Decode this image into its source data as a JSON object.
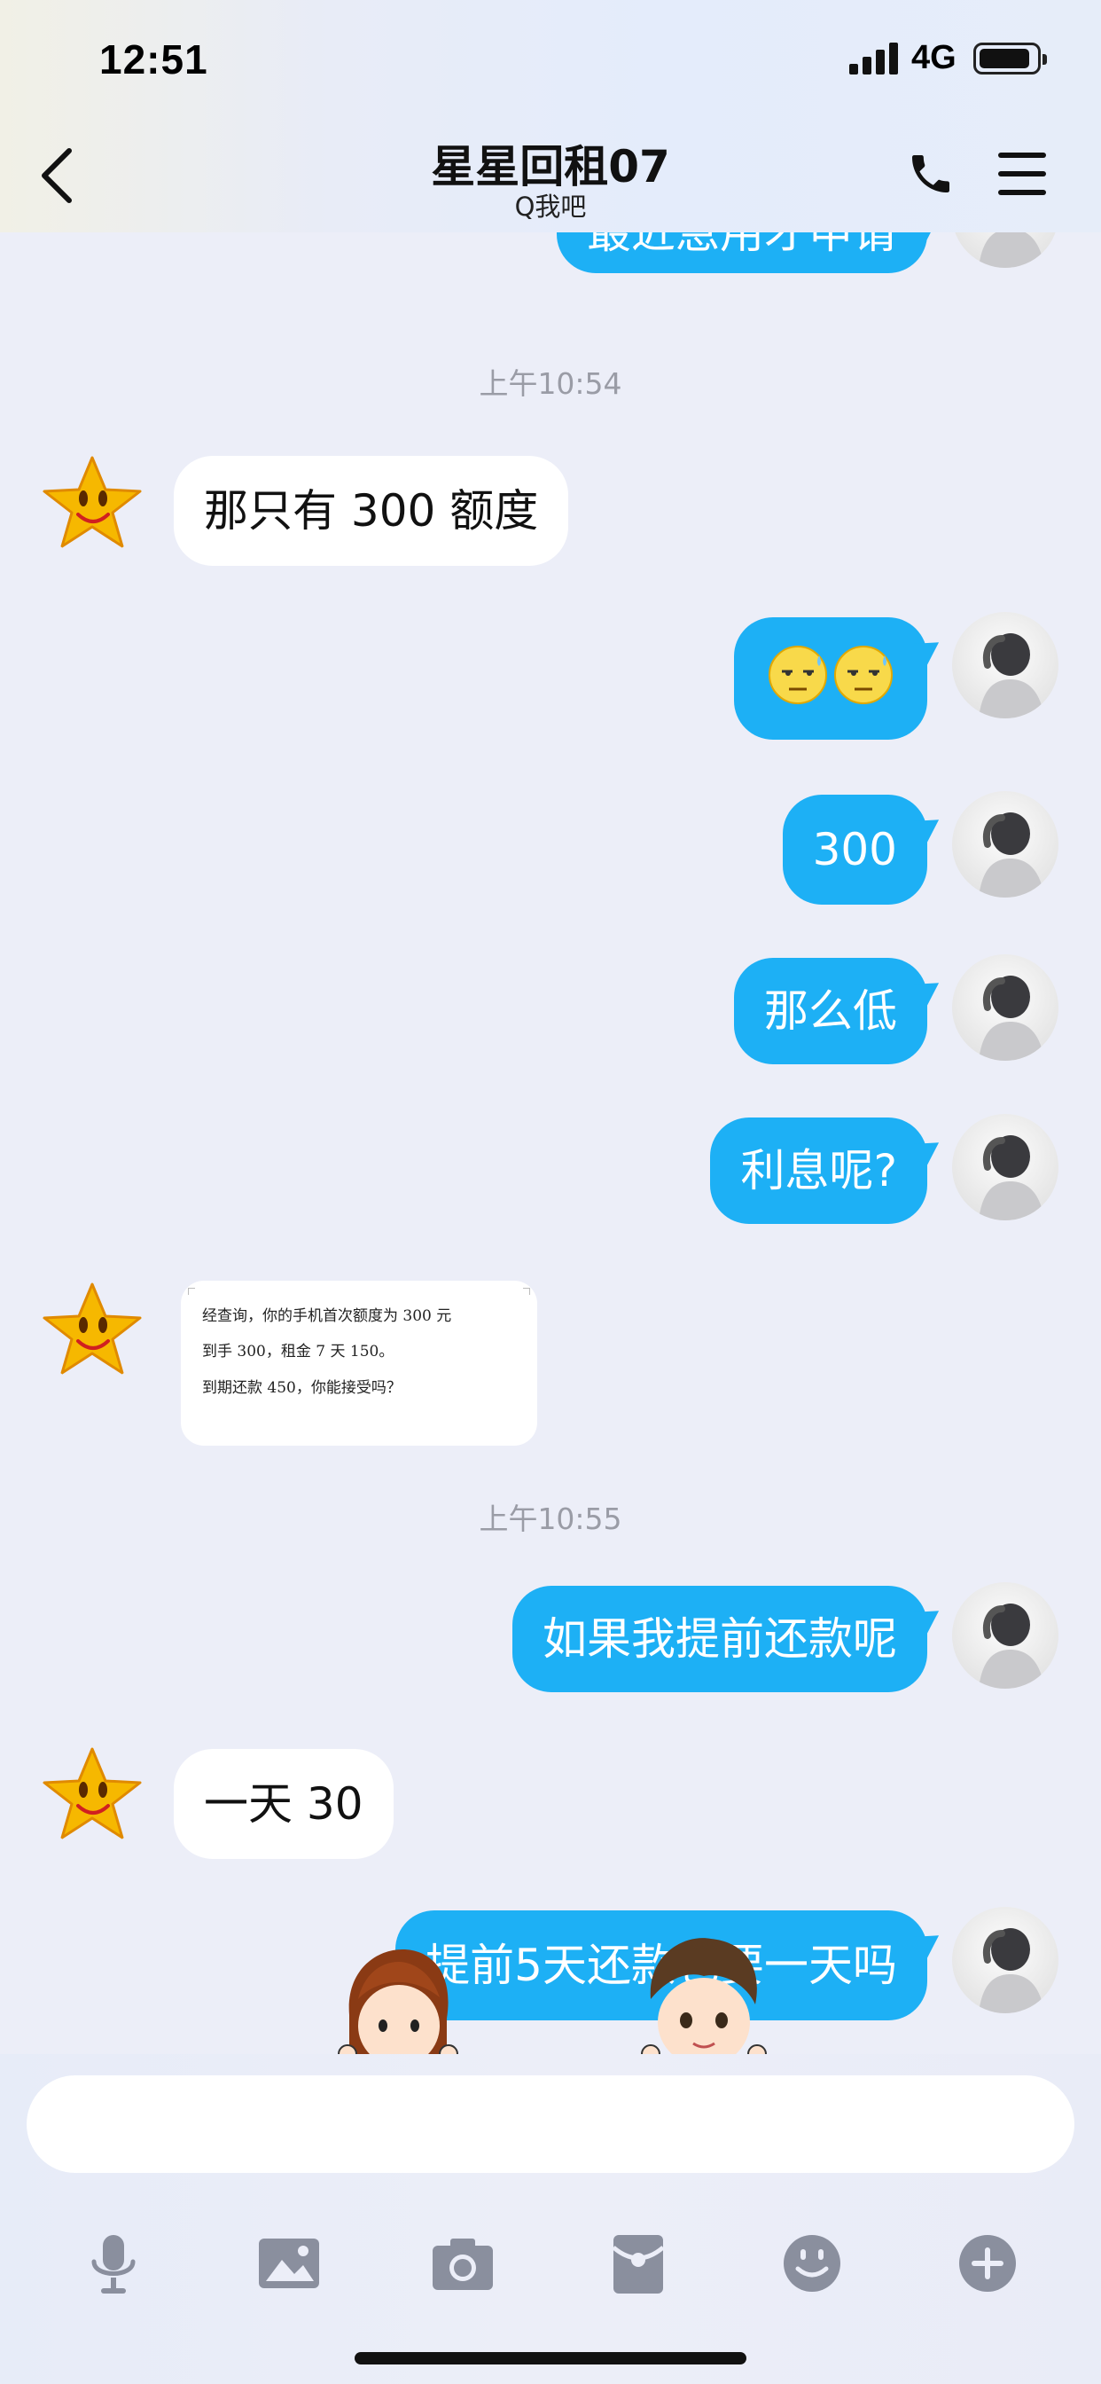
{
  "status_bar": {
    "time": "12:51",
    "network": "4G"
  },
  "nav": {
    "title": "星星回租07",
    "subtitle": "Q我吧"
  },
  "messages": {
    "m0": "最近急用才申请",
    "t1": "上午10:54",
    "m1": "那只有 300 额度",
    "m3": "300",
    "m4": "那么低",
    "m5": "利息呢?",
    "image_lines": [
      "经查询，你的手机首次额度为 300 元",
      "到手 300，租金 7 天 150。",
      "到期还款 450，你能接受吗？"
    ],
    "t2": "上午10:55",
    "m7": "如果我提前还款呢",
    "m8": "一天 30",
    "m9": "提前5天还款也要一天吗"
  },
  "input": {
    "placeholder": ""
  },
  "colors": {
    "outgoing_bubble": "#1db0f5",
    "incoming_bubble": "#ffffff",
    "background": "#eceef8",
    "timestamp": "#9a9ca6"
  },
  "icons": [
    "back-icon",
    "phone-icon",
    "menu-icon",
    "microphone-icon",
    "image-icon",
    "camera-icon",
    "red-packet-icon",
    "emoji-icon",
    "plus-icon"
  ]
}
